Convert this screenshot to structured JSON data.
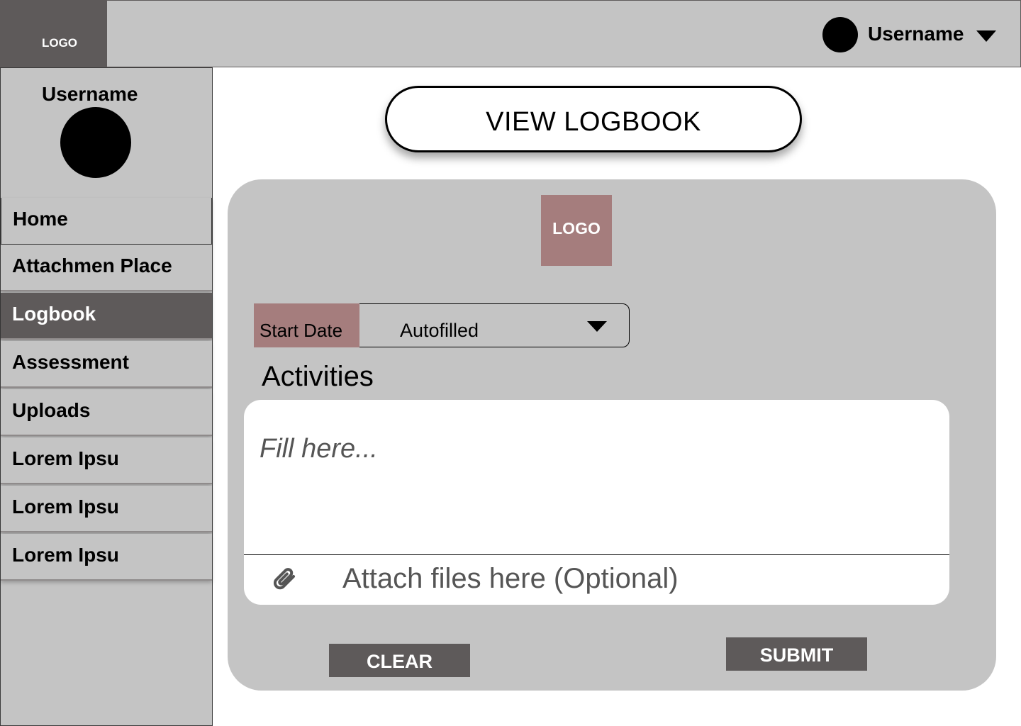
{
  "topbar": {
    "logo": "LOGO",
    "username": "Username"
  },
  "sidebar": {
    "username": "Username",
    "items": [
      {
        "label": "Home"
      },
      {
        "label": "Attachmen Place"
      },
      {
        "label": "Logbook"
      },
      {
        "label": "Assessment"
      },
      {
        "label": "Uploads"
      },
      {
        "label": "Lorem Ipsu"
      },
      {
        "label": "Lorem Ipsu"
      },
      {
        "label": "Lorem Ipsu"
      }
    ],
    "active_item": "Logbook"
  },
  "main": {
    "view_logbook_label": "VIEW LOGBOOK",
    "panel_logo": "LOGO",
    "start_date": {
      "label": "Start Date",
      "value": "Autofilled"
    },
    "activities": {
      "label": "Activities",
      "placeholder": "Fill here...",
      "attach_text": "Attach files here (Optional)"
    },
    "clear_label": "CLEAR",
    "submit_label": "SUBMIT"
  },
  "colors": {
    "dark_gray": "#5e5a5a",
    "light_gray": "#c4c4c4",
    "rose": "#a57d7d"
  },
  "icons": {
    "avatar": "avatar-circle",
    "dropdown": "caret-down-icon",
    "attach": "paperclip-icon"
  }
}
